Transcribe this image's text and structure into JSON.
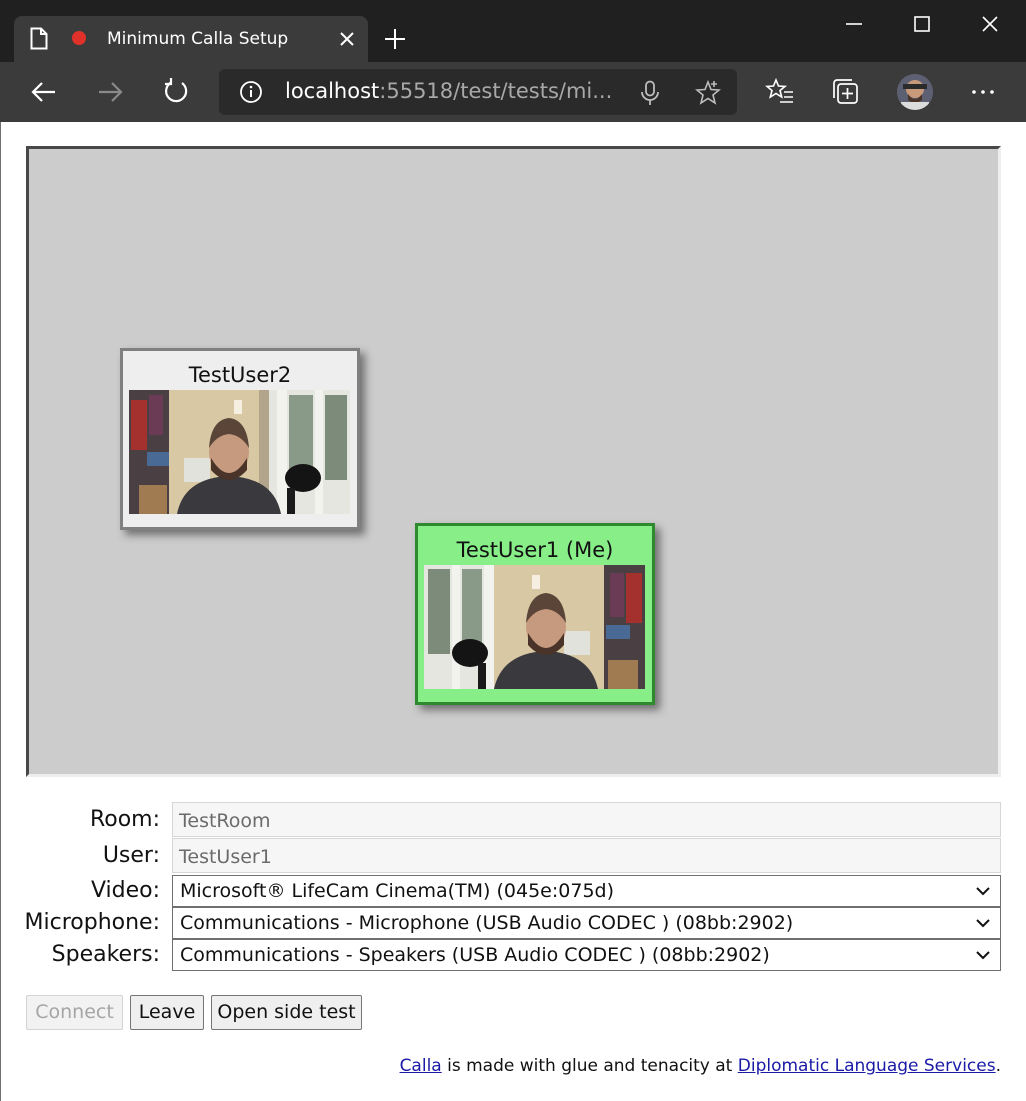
{
  "browser": {
    "tab_title": "Minimum Calla Setup",
    "url_host": "localhost",
    "url_rest": ":55518/test/tests/mi..."
  },
  "icons": {
    "page": "page-icon",
    "recording": "recording-dot-icon",
    "close_tab": "close-icon",
    "new_tab": "plus-icon",
    "back": "back-arrow-icon",
    "forward": "forward-arrow-icon",
    "refresh": "refresh-icon",
    "info": "info-icon",
    "mic": "microphone-icon",
    "favorite": "star-icon",
    "favorites": "favorites-list-icon",
    "collections": "collections-icon",
    "more": "more-icon"
  },
  "colors": {
    "stage_bg": "#cccccc",
    "me_tile_bg": "#88ee88",
    "me_tile_border": "#2f8a2f",
    "recording_dot": "#e0312a",
    "link": "#1a1aa6"
  },
  "participants": [
    {
      "name": "TestUser2"
    },
    {
      "name": "TestUser1 (Me)"
    }
  ],
  "form": {
    "room_label": "Room:",
    "room_value": "TestRoom",
    "user_label": "User:",
    "user_value": "TestUser1",
    "video_label": "Video:",
    "video_value": "Microsoft® LifeCam Cinema(TM) (045e:075d)",
    "mic_label": "Microphone:",
    "mic_value": "Communications - Microphone (USB Audio CODEC ) (08bb:2902)",
    "speakers_label": "Speakers:",
    "speakers_value": "Communications - Speakers (USB Audio CODEC ) (08bb:2902)"
  },
  "buttons": {
    "connect": "Connect",
    "leave": "Leave",
    "side_test": "Open side test"
  },
  "footer": {
    "link1": "Calla",
    "text": " is made with glue and tenacity at ",
    "link2": "Diplomatic Language Services",
    "end": "."
  }
}
